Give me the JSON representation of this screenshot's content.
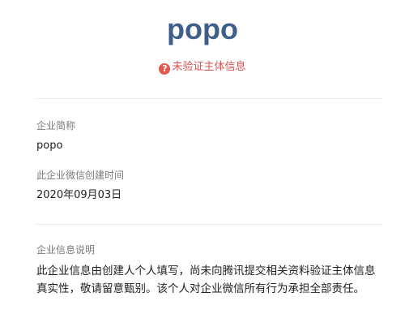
{
  "header": {
    "company_name": "popo",
    "verify_status_icon": "?",
    "verify_status_text": "未验证主体信息"
  },
  "fields": {
    "short_name_label": "企业简称",
    "short_name_value": "popo",
    "created_label": "此企业微信创建时间",
    "created_value": "2020年09月03日",
    "info_label": "企业信息说明",
    "info_value": "此企业信息由创建人个人填写，尚未向腾讯提交相关资料验证主体信息真实性，敬请留意甄别。该个人对企业微信所有行为承担全部责任。"
  },
  "colors": {
    "title": "#3f5f8a",
    "warning": "#d9534f",
    "label": "#7a7a7a",
    "text": "#222222"
  },
  "icons": {
    "verify_status": "question-circle-icon"
  }
}
